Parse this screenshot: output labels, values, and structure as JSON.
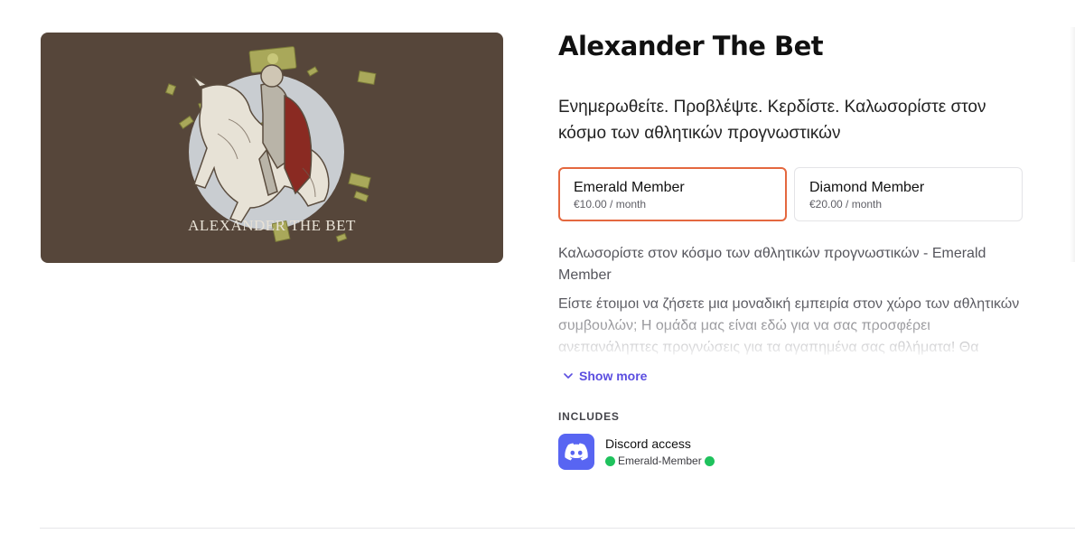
{
  "product": {
    "title": "Alexander The Bet",
    "banner_caption": "ALEXANDER THE BET",
    "tagline": "Ενημερωθείτε. Προβλέψτε. Κερδίστε. Καλωσορίστε στον κόσμο των αθλητικών προγνωστικών"
  },
  "plans": [
    {
      "name": "Emerald Member",
      "price": "€10.00 / month",
      "selected": true
    },
    {
      "name": "Diamond Member",
      "price": "€20.00 / month",
      "selected": false
    }
  ],
  "description": {
    "title": "Καλωσορίστε στον κόσμο των αθλητικών προγνωστικών - Emerald Member",
    "body": "Είστε έτοιμοι να ζήσετε μια μοναδική εμπειρία στον χώρο των αθλητικών συμβουλών; Η ομάδα μας είναι εδώ για να σας προσφέρει ανεπανάληπτες προγνώσεις για τα αγαπημένα σας αθλήματα! Θα",
    "show_more_label": "Show more"
  },
  "includes": {
    "label": "INCLUDES",
    "items": [
      {
        "title": "Discord access",
        "role": "Emerald-Member",
        "icon": "discord-icon",
        "role_dot_color": "#1fc25d"
      }
    ]
  },
  "colors": {
    "banner_bg": "#56463a",
    "selected_border": "#e4683f",
    "link": "#5b4ee0",
    "discord": "#5865f2"
  }
}
